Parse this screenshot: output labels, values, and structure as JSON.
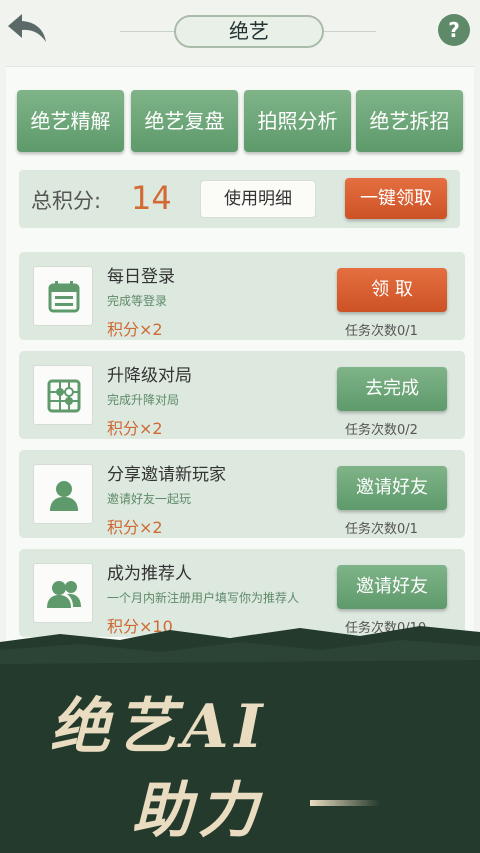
{
  "header": {
    "title": "绝艺"
  },
  "features": [
    "绝艺精解",
    "绝艺复盘",
    "拍照分析",
    "绝艺拆招"
  ],
  "score": {
    "label": "总积分:",
    "value": "14",
    "detail_label": "使用明细",
    "claim_all_label": "一键领取"
  },
  "tasks": [
    {
      "title": "每日登录",
      "desc": "完成等登录",
      "points": "积分×2",
      "button": "领 取",
      "count": "任务次数0/1",
      "icon": "calendar-icon"
    },
    {
      "title": "升降级对局",
      "desc": "完成升降对局",
      "points": "积分×2",
      "button": "去完成",
      "count": "任务次数0/2",
      "icon": "go-board-icon"
    },
    {
      "title": "分享邀请新玩家",
      "desc": "邀请好友一起玩",
      "points": "积分×2",
      "button": "邀请好友",
      "count": "任务次数0/1",
      "icon": "user-icon"
    },
    {
      "title": "成为推荐人",
      "desc": "一个月内新注册用户填写你为推荐人",
      "points": "积分×10",
      "button": "邀请好友",
      "count": "任务次数0/10",
      "icon": "users-icon"
    }
  ],
  "banner": {
    "line1": "绝艺AI",
    "line2": "助力"
  },
  "colors": {
    "green": "#5e9a6b",
    "orange": "#cc5225",
    "dark_banner": "#233a2c"
  }
}
